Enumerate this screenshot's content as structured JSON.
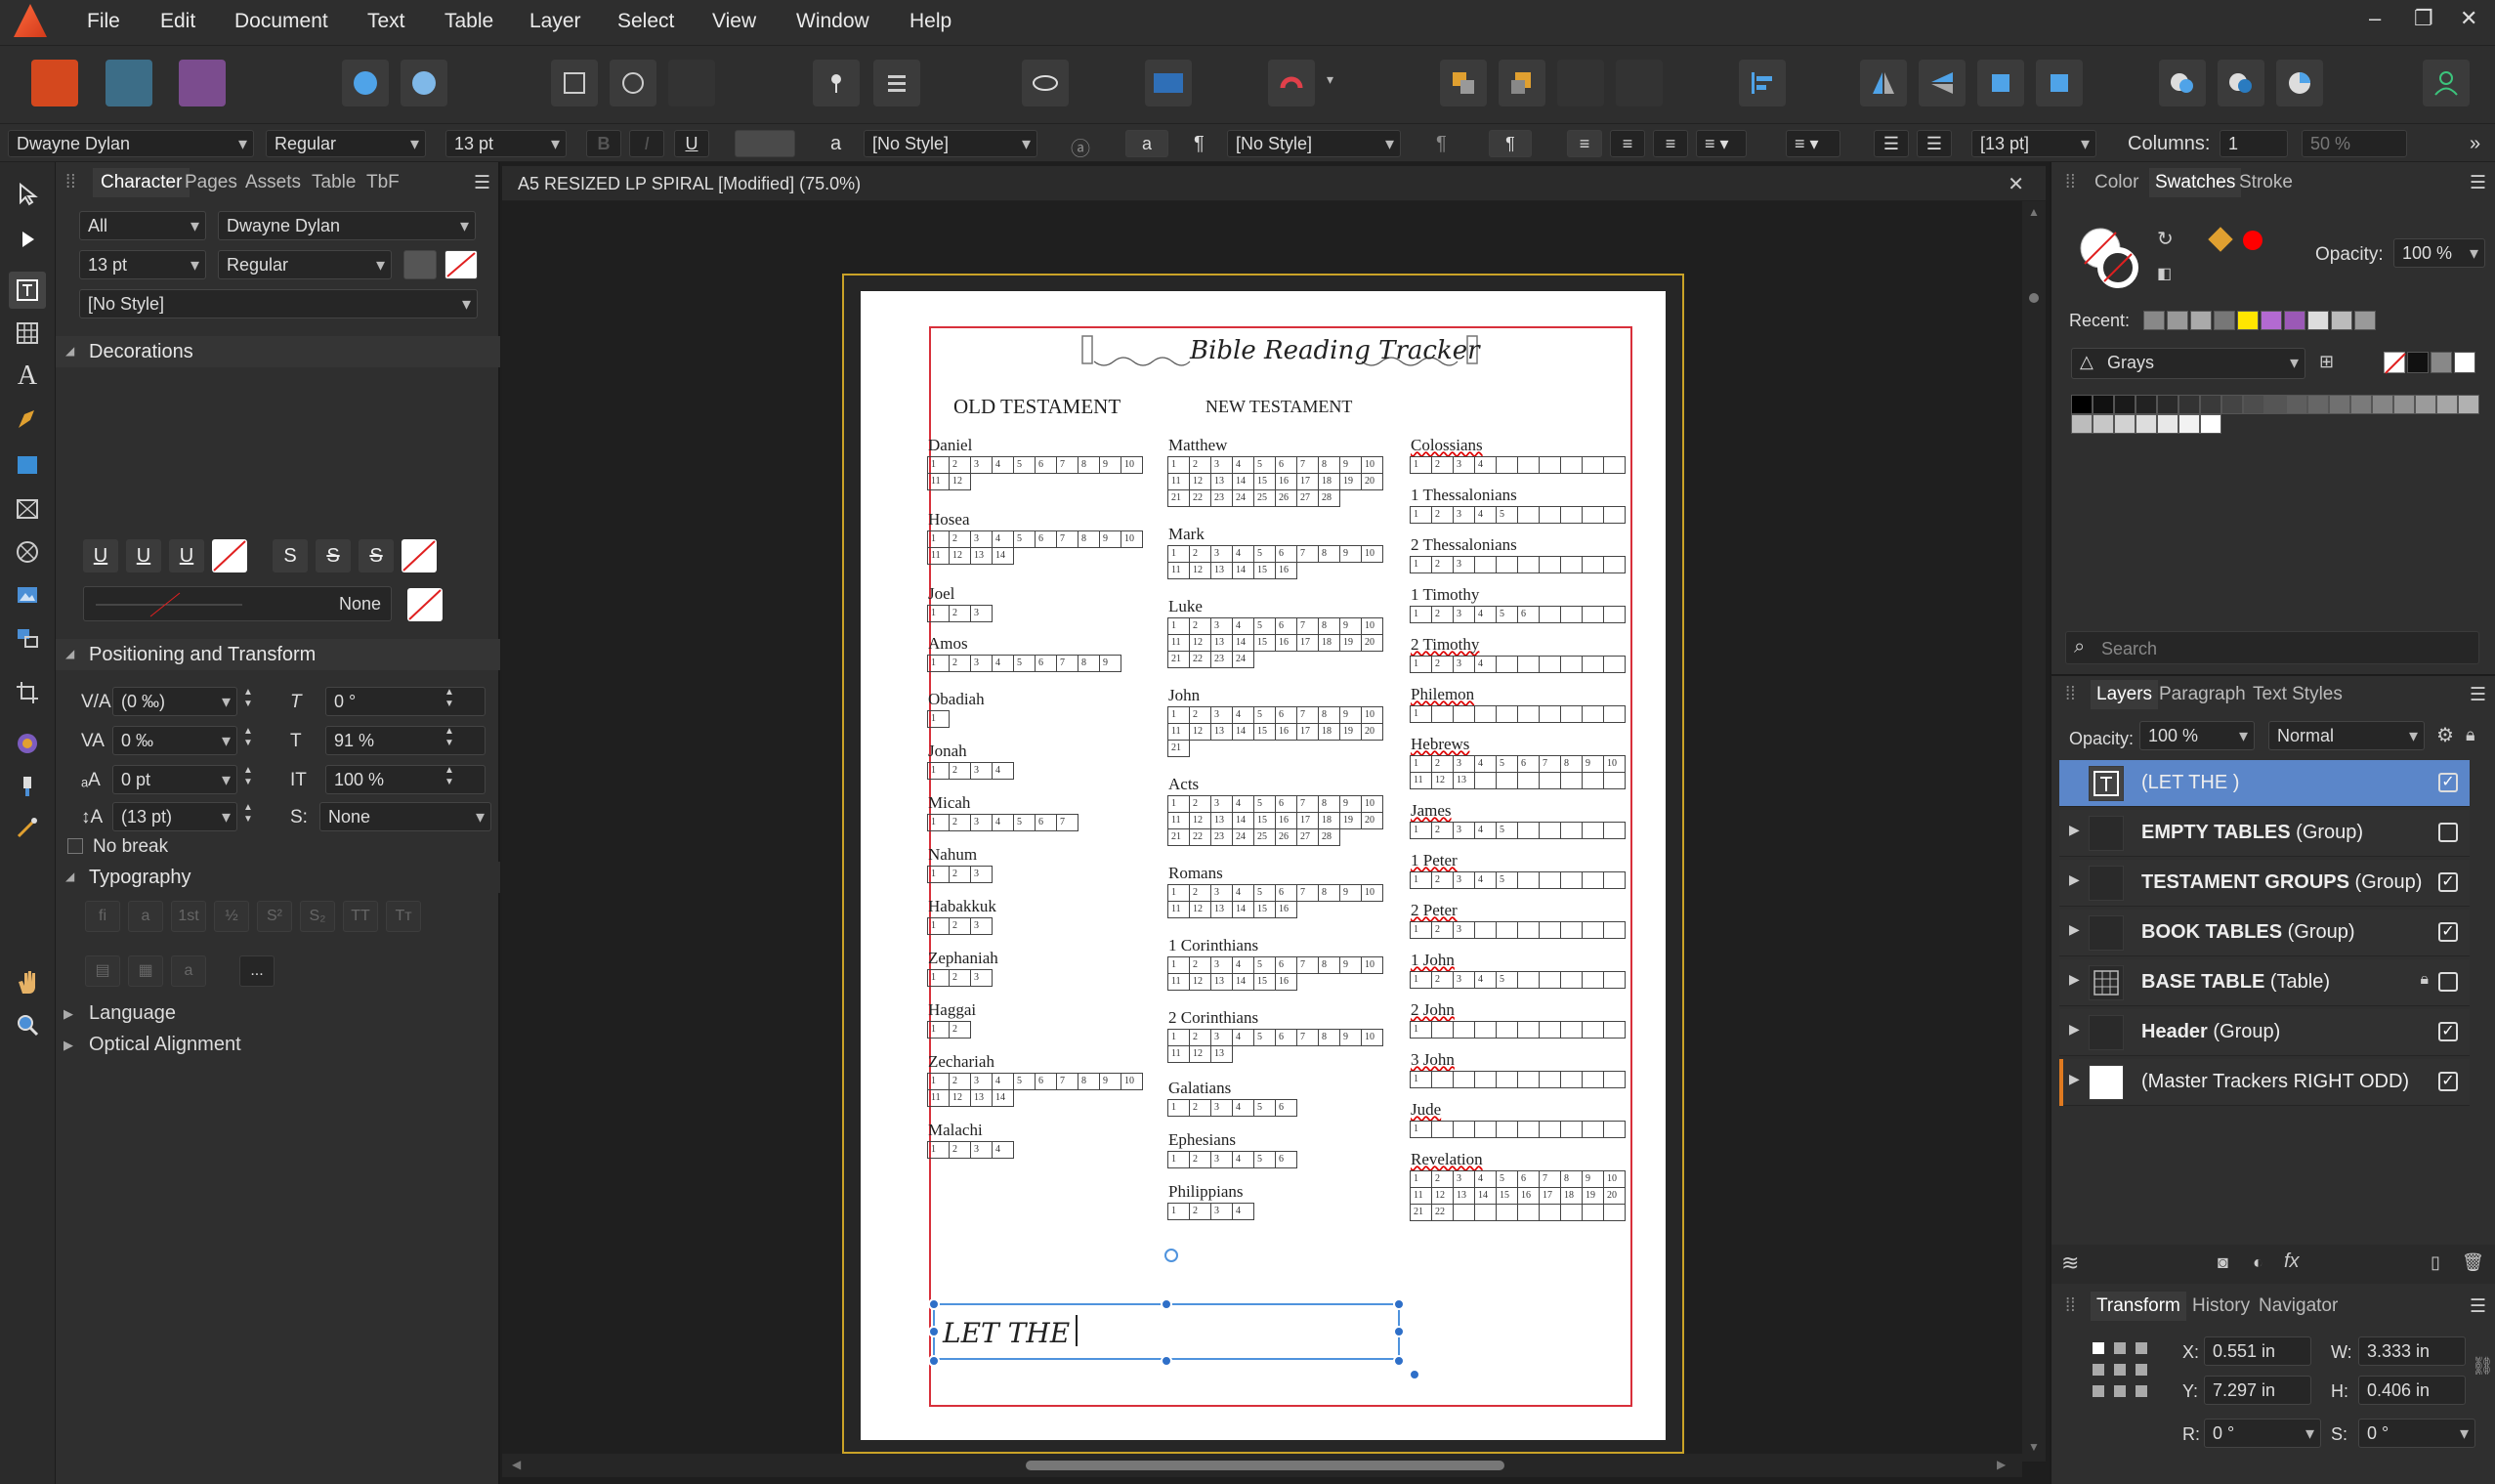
{
  "menu": [
    "File",
    "Edit",
    "Document",
    "Text",
    "Table",
    "Layer",
    "Select",
    "View",
    "Window",
    "Help"
  ],
  "context_bar": {
    "font": "Dwayne Dylan",
    "style": "Regular",
    "size": "13 pt",
    "para_style_1": "[No Style]",
    "para_style_2": "[No Style]",
    "leading": "[13 pt]",
    "columns_label": "Columns:",
    "columns": "1",
    "gutter": "50 %"
  },
  "left_panel": {
    "tabs": [
      "Character",
      "Pages",
      "Assets",
      "Table",
      "TbF"
    ],
    "scope": "All",
    "font": "Dwayne Dylan",
    "size": "13 pt",
    "style": "Regular",
    "char_style": "[No Style]",
    "decorations": "Decorations",
    "deco_none": "None",
    "positioning": "Positioning and Transform",
    "kerning": "(0 ‰)",
    "tracking": "0 ‰",
    "baseline": "0 pt",
    "leading": "(13 pt)",
    "shear": "0 °",
    "vscale": "91 %",
    "hscale": "100 %",
    "script": "None",
    "no_break": "No break",
    "typography": "Typography",
    "language": "Language",
    "optical": "Optical Alignment",
    "more": "..."
  },
  "document": {
    "tab_title": "A5 RESIZED LP SPIRAL [Modified] (75.0%)",
    "tracker_title": "Bible Reading Tracker",
    "old_testament": "OLD TESTAMENT",
    "new_testament": "NEW TESTAMENT",
    "editing_text": "LET THE",
    "old_books": [
      {
        "name": "Daniel",
        "n": 12
      },
      {
        "name": "Hosea",
        "n": 14
      },
      {
        "name": "Joel",
        "n": 3
      },
      {
        "name": "Amos",
        "n": 9
      },
      {
        "name": "Obadiah",
        "n": 1
      },
      {
        "name": "Jonah",
        "n": 4
      },
      {
        "name": "Micah",
        "n": 7
      },
      {
        "name": "Nahum",
        "n": 3
      },
      {
        "name": "Habakkuk",
        "n": 3
      },
      {
        "name": "Zephaniah",
        "n": 3
      },
      {
        "name": "Haggai",
        "n": 2
      },
      {
        "name": "Zechariah",
        "n": 14
      },
      {
        "name": "Malachi",
        "n": 4
      }
    ],
    "new_books": [
      {
        "name": "Matthew",
        "n": 28
      },
      {
        "name": "Mark",
        "n": 16
      },
      {
        "name": "Luke",
        "n": 24
      },
      {
        "name": "John",
        "n": 21
      },
      {
        "name": "Acts",
        "n": 28
      },
      {
        "name": "Romans",
        "n": 16
      },
      {
        "name": "1 Corinthians",
        "n": 16
      },
      {
        "name": "2 Corinthians",
        "n": 13
      },
      {
        "name": "Galatians",
        "n": 6
      },
      {
        "name": "Ephesians",
        "n": 6
      },
      {
        "name": "Philippians",
        "n": 4
      }
    ],
    "right_books": [
      {
        "name": "Colossians",
        "n": 4
      },
      {
        "name": "1 Thessalonians",
        "n": 5
      },
      {
        "name": "2 Thessalonians",
        "n": 3
      },
      {
        "name": "1 Timothy",
        "n": 6
      },
      {
        "name": "2 Timothy",
        "n": 4
      },
      {
        "name": "Philemon",
        "n": 1
      },
      {
        "name": "Hebrews",
        "n": 13
      },
      {
        "name": "James",
        "n": 5
      },
      {
        "name": "1 Peter",
        "n": 5
      },
      {
        "name": "2 Peter",
        "n": 3
      },
      {
        "name": "1 John",
        "n": 5
      },
      {
        "name": "2 John",
        "n": 1
      },
      {
        "name": "3 John",
        "n": 1
      },
      {
        "name": "Jude",
        "n": 1
      },
      {
        "name": "Revelation",
        "n": 22
      }
    ]
  },
  "right_panel": {
    "tabs": [
      "Color",
      "Swatches",
      "Stroke"
    ],
    "opacity_label": "Opacity:",
    "opacity": "100 %",
    "recent_label": "Recent:",
    "palette": "Grays",
    "search_placeholder": "Search",
    "layer_tabs": [
      "Layers",
      "Paragraph",
      "Text Styles"
    ],
    "layer_opacity": "100 %",
    "blend": "Normal",
    "layers": [
      {
        "name": "(LET THE  )",
        "bold": "",
        "suffix": "",
        "selected": true,
        "checked": true
      },
      {
        "name": "",
        "bold": "EMPTY TABLES",
        "suffix": " (Group)",
        "selected": false,
        "checked": false
      },
      {
        "name": "",
        "bold": "TESTAMENT GROUPS",
        "suffix": " (Group)",
        "selected": false,
        "checked": true
      },
      {
        "name": "",
        "bold": "BOOK TABLES",
        "suffix": " (Group)",
        "selected": false,
        "checked": true
      },
      {
        "name": "",
        "bold": "BASE TABLE",
        "suffix": " (Table)",
        "selected": false,
        "checked": false
      },
      {
        "name": "",
        "bold": "Header",
        "suffix": " (Group)",
        "selected": false,
        "checked": true
      },
      {
        "name": "(Master Trackers RIGHT ODD)",
        "bold": "",
        "suffix": "",
        "selected": false,
        "checked": true
      }
    ],
    "bottom_tabs": [
      "Transform",
      "History",
      "Navigator"
    ],
    "x": "0.551 in",
    "y": "7.297 in",
    "w": "3.333 in",
    "h": "0.406 in",
    "r": "0 °",
    "s": "0 °"
  }
}
